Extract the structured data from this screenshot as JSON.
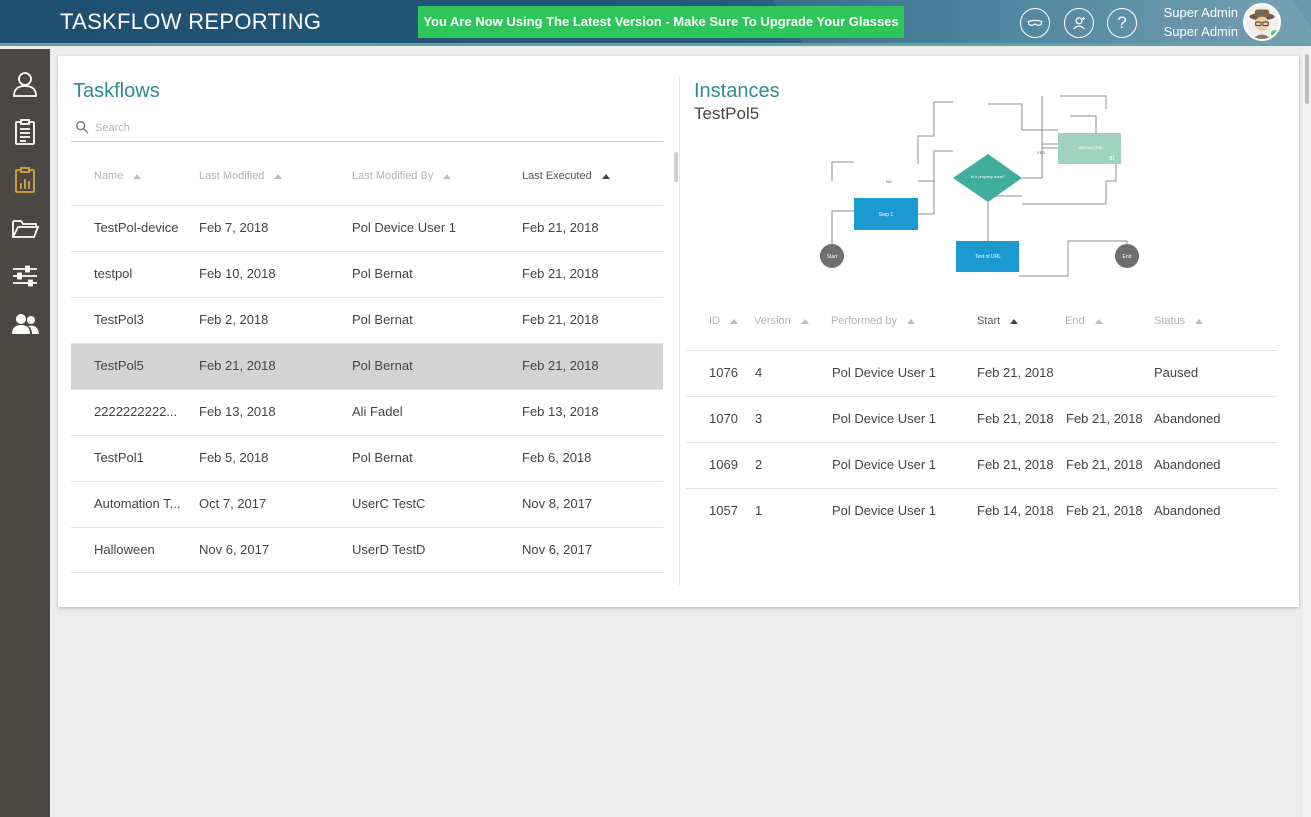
{
  "header": {
    "app_title": "TASKFLOW REPORTING",
    "banner": "You Are Now Using The Latest Version - Make Sure To Upgrade Your Glasses",
    "icons": [
      "glasses-icon",
      "user-account-icon",
      "help-icon"
    ],
    "help_symbol": "?",
    "user_name": "Super Admin",
    "user_role": "Super Admin"
  },
  "sidebar": {
    "items": [
      {
        "icon": "user-icon",
        "active": true
      },
      {
        "icon": "clipboard-list-icon",
        "active": true
      },
      {
        "icon": "chart-report-icon",
        "active": true,
        "color": "#d6a53e"
      },
      {
        "icon": "folder-open-icon",
        "active": true
      },
      {
        "icon": "sliders-icon",
        "active": true
      },
      {
        "icon": "users-icon",
        "active": true
      }
    ]
  },
  "taskflows": {
    "title": "Taskflows",
    "search_placeholder": "Search",
    "columns": [
      "Name",
      "Last Modified",
      "Last Modified By",
      "Last Executed"
    ],
    "sorted_column": "Last Executed",
    "rows": [
      {
        "name": "TestPol-device",
        "modified": "Feb 7, 2018",
        "by": "Pol Device User 1",
        "executed": "Feb 21, 2018"
      },
      {
        "name": "testpol",
        "modified": "Feb 10, 2018",
        "by": "Pol Bernat",
        "executed": "Feb 21, 2018"
      },
      {
        "name": "TestPol3",
        "modified": "Feb 2, 2018",
        "by": "Pol Bernat",
        "executed": "Feb 21, 2018"
      },
      {
        "name": "TestPol5",
        "modified": "Feb 21, 2018",
        "by": "Pol Bernat",
        "executed": "Feb 21, 2018"
      },
      {
        "name": "2222222222...",
        "modified": "Feb 13, 2018",
        "by": "Ali Fadel",
        "executed": "Feb 13, 2018"
      },
      {
        "name": "TestPol1",
        "modified": "Feb 5, 2018",
        "by": "Pol Bernat",
        "executed": "Feb 6, 2018"
      },
      {
        "name": "Automation T...",
        "modified": "Oct 7, 2017",
        "by": "UserC TestC",
        "executed": "Nov 8, 2017"
      },
      {
        "name": "Halloween",
        "modified": "Nov 6, 2017",
        "by": "UserD TestD",
        "executed": "Nov 6, 2017"
      }
    ],
    "selected_row": "TestPol5"
  },
  "instances": {
    "title": "Instances",
    "subtitle": "TestPol5",
    "diagram": {
      "start_label": "Start",
      "end_label": "End",
      "step1_label": "Step 1",
      "decision_label": "Is it properly done?",
      "test_url_label": "Test of URL",
      "abc_label": "ABCabc123$",
      "abc_badge": "$1",
      "edge_no": "NO",
      "edge_yes": "YES"
    },
    "columns": [
      "ID",
      "Version",
      "Performed by",
      "Start",
      "End",
      "Status"
    ],
    "sorted_column": "Start",
    "rows": [
      {
        "id": "1076",
        "version": "4",
        "by": "Pol Device User 1",
        "start": "Feb 21, 2018",
        "end": "",
        "status": "Paused"
      },
      {
        "id": "1070",
        "version": "3",
        "by": "Pol Device User 1",
        "start": "Feb 21, 2018",
        "end": "Feb 21, 2018",
        "status": "Abandoned"
      },
      {
        "id": "1069",
        "version": "2",
        "by": "Pol Device User 1",
        "start": "Feb 21, 2018",
        "end": "Feb 21, 2018",
        "status": "Abandoned"
      },
      {
        "id": "1057",
        "version": "1",
        "by": "Pol Device User 1",
        "start": "Feb 14, 2018",
        "end": "Feb 21, 2018",
        "status": "Abandoned"
      }
    ]
  },
  "colors": {
    "header_bg": "#1f4f70",
    "banner_bg": "#2ec55a",
    "accent_teal": "#2e8b8f",
    "sidebar_bg": "#4b4844",
    "selected_row_bg": "#d3d3d3",
    "node_blue": "#1a9ad0",
    "node_teal": "#3fae9c",
    "node_mint": "#9fd3bf"
  }
}
